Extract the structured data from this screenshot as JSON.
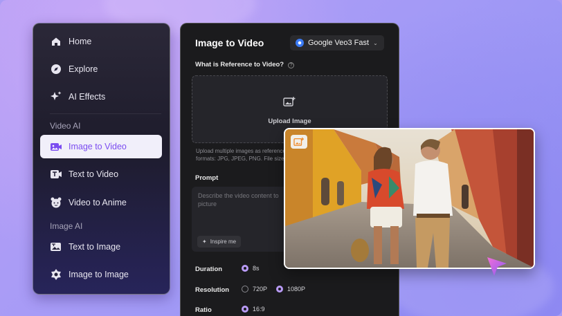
{
  "sidebar": {
    "items": [
      {
        "label": "Home",
        "icon": "home-icon"
      },
      {
        "label": "Explore",
        "icon": "compass-icon"
      },
      {
        "label": "AI Effects",
        "icon": "sparkle-icon"
      }
    ],
    "section_video": "Video AI",
    "video_items": [
      {
        "label": "Image to Video",
        "icon": "image-video-icon",
        "active": true
      },
      {
        "label": "Text to Video",
        "icon": "text-video-icon"
      },
      {
        "label": "Video to Anime",
        "icon": "anime-icon"
      }
    ],
    "section_image": "Image AI",
    "image_items": [
      {
        "label": "Text to Image",
        "icon": "text-image-icon"
      },
      {
        "label": "Image to Image",
        "icon": "image-image-icon"
      }
    ]
  },
  "panel": {
    "title": "Image to Video",
    "model": "Google Veo3 Fast",
    "reference_question": "What is Reference to Video?",
    "upload_label": "Upload Image",
    "upload_hint_line1": "Upload multiple images as reference",
    "upload_hint_line2": "formats: JPG, JPEG, PNG. File size:s",
    "prompt_label": "Prompt",
    "prompt_placeholder": "Describe the video content to picture",
    "inspire_label": "Inspire me",
    "duration_label": "Duration",
    "duration_value": "8s",
    "resolution_label": "Resolution",
    "resolution_options": [
      "720P",
      "1080P"
    ],
    "resolution_selected": "1080P",
    "ratio_label": "Ratio",
    "ratio_value": "16:9"
  },
  "colors": {
    "accent": "#7b4cf0",
    "radio_on": "#b99bf7",
    "panel_bg": "#1b1b1d"
  }
}
